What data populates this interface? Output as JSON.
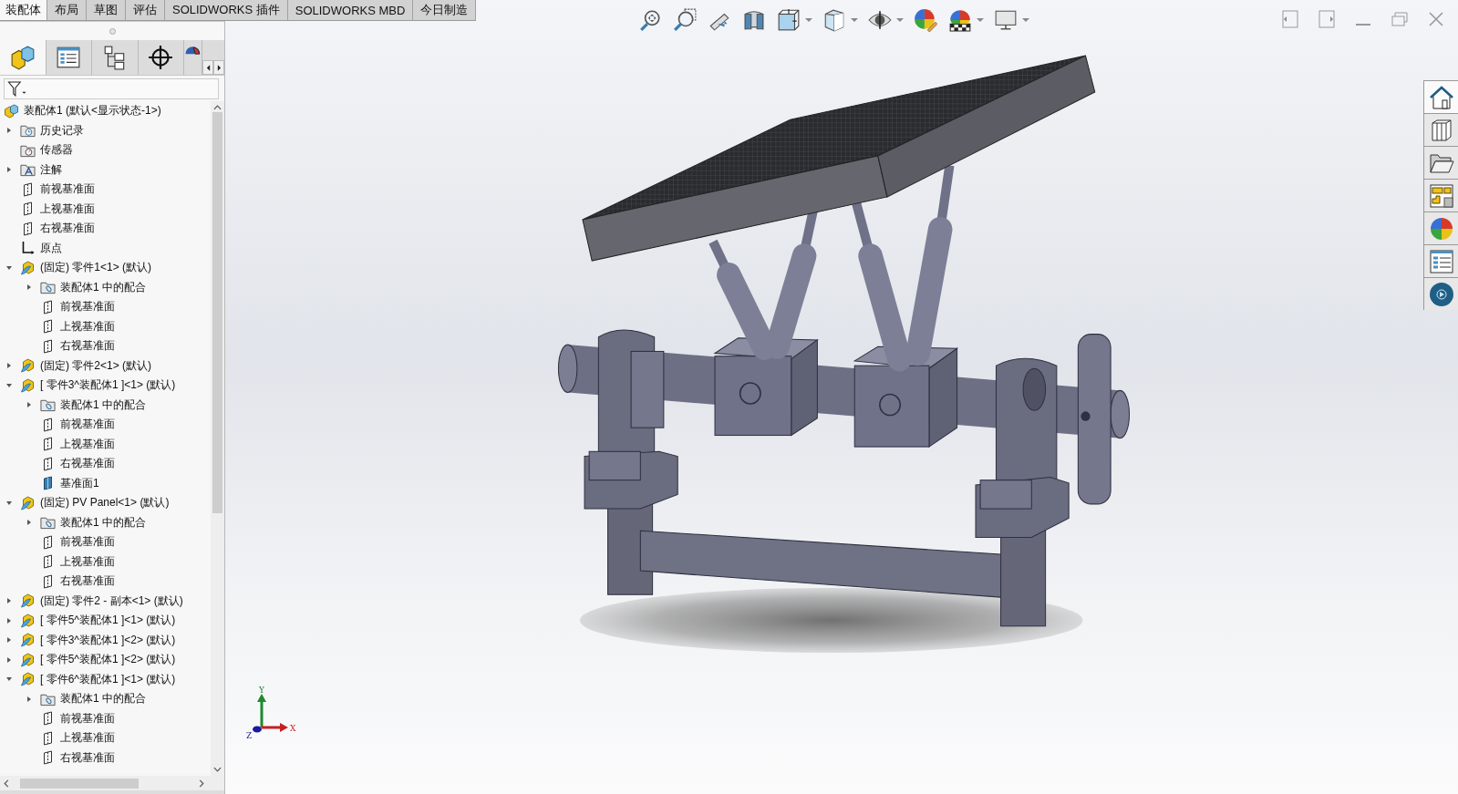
{
  "command_tabs": [
    {
      "label": "装配体",
      "selected": true
    },
    {
      "label": "布局",
      "selected": false
    },
    {
      "label": "草图",
      "selected": false
    },
    {
      "label": "评估",
      "selected": false
    },
    {
      "label": "SOLIDWORKS 插件",
      "selected": false
    },
    {
      "label": "SOLIDWORKS MBD",
      "selected": false
    },
    {
      "label": "今日制造",
      "selected": false
    }
  ],
  "panel_tabs": [
    {
      "kind": "feature-manager",
      "selected": true
    },
    {
      "kind": "property-manager",
      "selected": false
    },
    {
      "kind": "configuration-manager",
      "selected": false
    },
    {
      "kind": "dimxpert",
      "selected": false
    },
    {
      "kind": "display-manager",
      "selected": false
    }
  ],
  "tree": {
    "label": "装配体1  (默认<显示状态-1>)",
    "kind": "assembly",
    "children": [
      {
        "label": "历史记录",
        "kind": "history",
        "expanded": false
      },
      {
        "label": "传感器",
        "kind": "sensor"
      },
      {
        "label": "注解",
        "kind": "annotation",
        "expanded": false
      },
      {
        "label": "前视基准面",
        "kind": "plane"
      },
      {
        "label": "上视基准面",
        "kind": "plane"
      },
      {
        "label": "右视基准面",
        "kind": "plane"
      },
      {
        "label": "原点",
        "kind": "origin"
      },
      {
        "label": "(固定) 零件1<1> (默认)",
        "kind": "part",
        "expanded": true,
        "children": [
          {
            "label": "装配体1 中的配合",
            "kind": "mates",
            "expanded": false
          },
          {
            "label": "前视基准面",
            "kind": "plane"
          },
          {
            "label": "上视基准面",
            "kind": "plane"
          },
          {
            "label": "右视基准面",
            "kind": "plane"
          }
        ]
      },
      {
        "label": "(固定) 零件2<1> (默认)",
        "kind": "part",
        "expanded": false
      },
      {
        "label": "[ 零件3^装配体1 ]<1> (默认)",
        "kind": "part",
        "expanded": true,
        "children": [
          {
            "label": "装配体1 中的配合",
            "kind": "mates",
            "expanded": false
          },
          {
            "label": "前视基准面",
            "kind": "plane"
          },
          {
            "label": "上视基准面",
            "kind": "plane"
          },
          {
            "label": "右视基准面",
            "kind": "plane"
          },
          {
            "label": "基准面1",
            "kind": "plane-solid"
          }
        ]
      },
      {
        "label": "(固定) PV Panel<1> (默认)",
        "kind": "part",
        "expanded": true,
        "children": [
          {
            "label": "装配体1 中的配合",
            "kind": "mates",
            "expanded": false
          },
          {
            "label": "前视基准面",
            "kind": "plane"
          },
          {
            "label": "上视基准面",
            "kind": "plane"
          },
          {
            "label": "右视基准面",
            "kind": "plane"
          }
        ]
      },
      {
        "label": "(固定) 零件2 - 副本<1> (默认)",
        "kind": "part",
        "expanded": false
      },
      {
        "label": "[ 零件5^装配体1 ]<1> (默认)",
        "kind": "part",
        "expanded": false
      },
      {
        "label": "[ 零件3^装配体1 ]<2> (默认)",
        "kind": "part",
        "expanded": false
      },
      {
        "label": "[ 零件5^装配体1 ]<2> (默认)",
        "kind": "part",
        "expanded": false
      },
      {
        "label": "[ 零件6^装配体1 ]<1> (默认)",
        "kind": "part",
        "expanded": true,
        "children": [
          {
            "label": "装配体1 中的配合",
            "kind": "mates",
            "expanded": false
          },
          {
            "label": "前视基准面",
            "kind": "plane"
          },
          {
            "label": "上视基准面",
            "kind": "plane"
          },
          {
            "label": "右视基准面",
            "kind": "plane"
          }
        ]
      }
    ]
  },
  "triad": {
    "x": "X",
    "y": "Y",
    "z": "Z"
  }
}
